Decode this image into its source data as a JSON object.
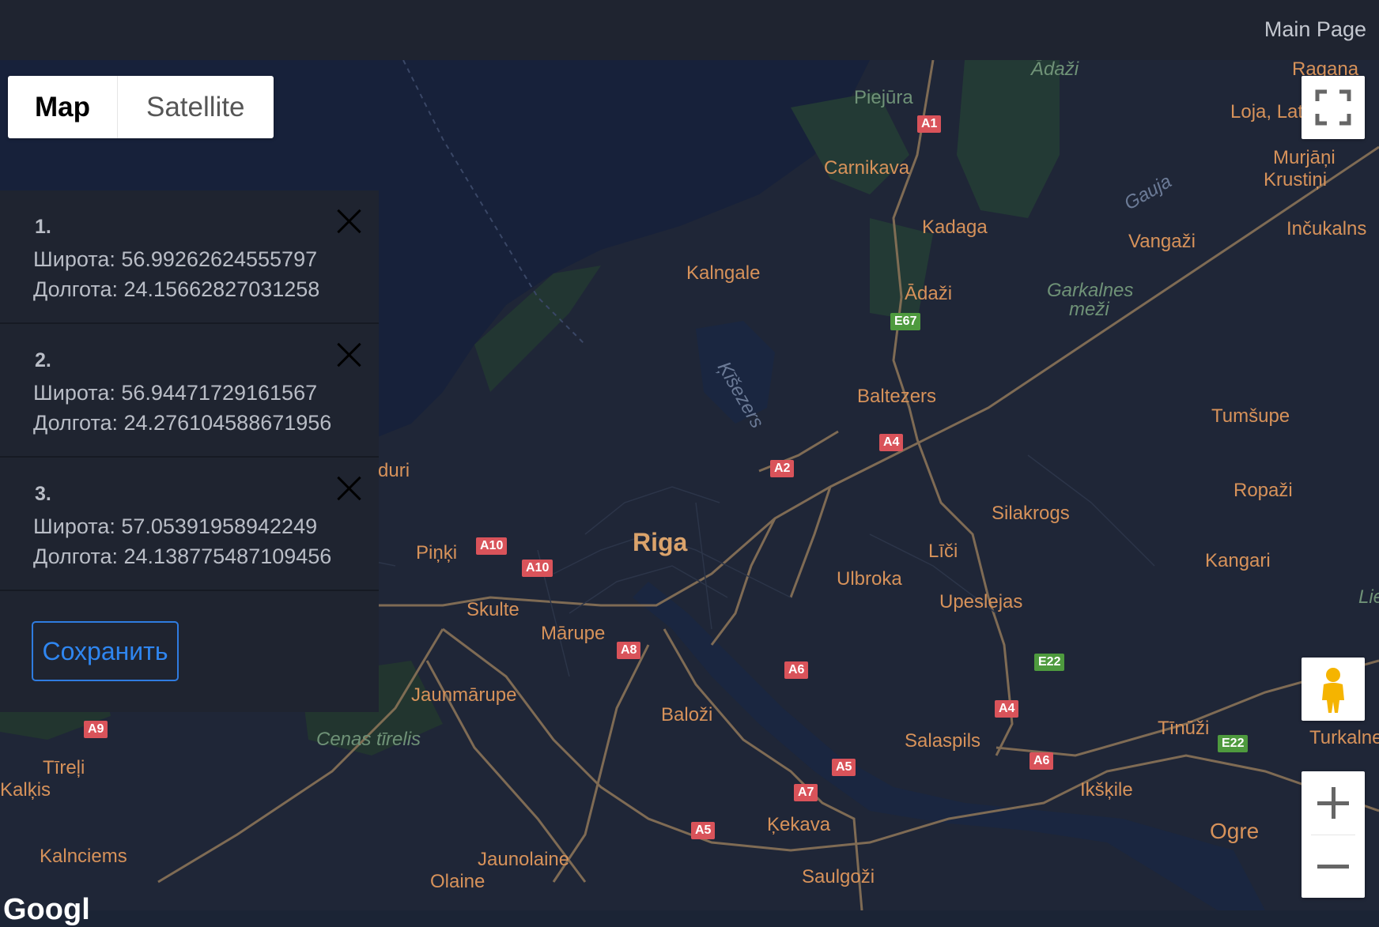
{
  "header": {
    "nav_link": "Main Page"
  },
  "map_type": {
    "map_label": "Map",
    "satellite_label": "Satellite",
    "active": "Map"
  },
  "points": [
    {
      "num": "1.",
      "lat_label": "Широта: 56.99262624555797",
      "lng_label": "Долгота: 24.15662827031258"
    },
    {
      "num": "2.",
      "lat_label": "Широта: 56.94471729161567",
      "lng_label": "Долгота: 24.276104588671956"
    },
    {
      "num": "3.",
      "lat_label": "Широта: 57.05391958942249",
      "lng_label": "Долгота: 24.138775487109456"
    }
  ],
  "save_label": "Сохранить",
  "places": {
    "adazi_top": "Ādaži",
    "ragana": "Ragana",
    "latvia": "Loja, Lat",
    "piejura": "Piejūra",
    "carnikava": "Carnikava",
    "murjani": "Murjāņi",
    "krustini": "Krustiņi",
    "gauja": "Gauja",
    "kadaga": "Kadaga",
    "vangazi": "Vangaži",
    "incukalns": "Inčukalns",
    "kalngale": "Kalngale",
    "adazi": "Ādaži",
    "garkalnes1": "Garkalnes",
    "garkalnes2": "meži",
    "kisezers": "Ķīšezers",
    "baltezers": "Baltezers",
    "tumsupe": "Tumšupe",
    "duri": "duri",
    "ropazi": "Ropaži",
    "silakrogs": "Silakrogs",
    "riga": "Riga",
    "pinki": "Piņķi",
    "lici": "Līči",
    "kangari": "Kangari",
    "ulbroka": "Ulbroka",
    "skulte": "Skulte",
    "upeslejas": "Upeslejas",
    "lielie": "Lielie",
    "marupe": "Mārupe",
    "jaunmarupe": "Jaunmārupe",
    "balozi": "Baloži",
    "tinuzi": "Tīnūži",
    "turkalne": "Turkalne",
    "cenas": "Cenas tīrelis",
    "salaspils": "Salaspils",
    "tireli": "Tīreļi",
    "kalkis": "Kalķis",
    "ikskile": "Ikšķile",
    "kekava": "Ķekava",
    "ogre": "Ogre",
    "kalnciems": "Kalnciems",
    "jaunolaine": "Jaunolaine",
    "saulgozi": "Saulgoži",
    "olaine": "Olaine",
    "google": "Googl"
  },
  "roads": {
    "a1": "A1",
    "e67": "E67",
    "a4a": "A4",
    "a2": "A2",
    "a10a": "A10",
    "a10b": "A10",
    "a8": "A8",
    "a6a": "A6",
    "e22a": "E22",
    "a9": "A9",
    "a4b": "A4",
    "e22b": "E22",
    "a6b": "A6",
    "a5a": "A5",
    "a7": "A7",
    "a5b": "A5"
  },
  "colors": {
    "land": "#1f2637",
    "sea": "#17213a",
    "forest": "#233a35",
    "road": "#8a7358",
    "label": "#d7925a",
    "accent": "#2f86f0"
  }
}
